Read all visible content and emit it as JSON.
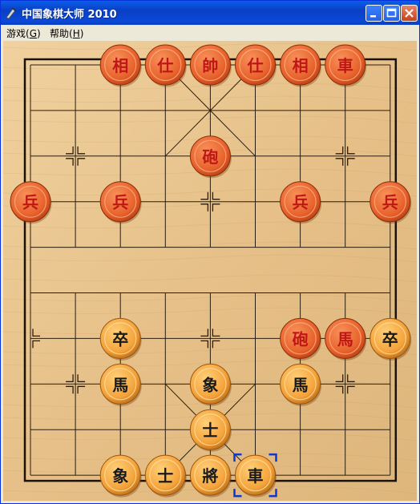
{
  "window": {
    "title": "中国象棋大师 2010",
    "minimize_label": "",
    "maximize_label": "",
    "close_label": ""
  },
  "menu": {
    "game": {
      "label": "游戏",
      "shortcut": "G"
    },
    "help": {
      "label": "帮助",
      "shortcut": "H"
    }
  },
  "colors": {
    "titlebar": "#0a4fd6",
    "board_wood": "#e9c58f",
    "red_piece_face": "#e9652f",
    "red_piece_text": "#c01616",
    "black_piece_face": "#f2a43a",
    "black_piece_text": "#1a1a1a",
    "selection": "#1038d0"
  },
  "board": {
    "files": 9,
    "ranks": 10,
    "red_pieces": [
      {
        "file": 2,
        "rank": 0,
        "label": "相"
      },
      {
        "file": 3,
        "rank": 0,
        "label": "仕"
      },
      {
        "file": 4,
        "rank": 0,
        "label": "帥"
      },
      {
        "file": 5,
        "rank": 0,
        "label": "仕"
      },
      {
        "file": 6,
        "rank": 0,
        "label": "相"
      },
      {
        "file": 7,
        "rank": 0,
        "label": "車"
      },
      {
        "file": 4,
        "rank": 2,
        "label": "砲"
      },
      {
        "file": 0,
        "rank": 3,
        "label": "兵"
      },
      {
        "file": 2,
        "rank": 3,
        "label": "兵"
      },
      {
        "file": 6,
        "rank": 3,
        "label": "兵"
      },
      {
        "file": 8,
        "rank": 3,
        "label": "兵"
      },
      {
        "file": 6,
        "rank": 6,
        "label": "砲"
      },
      {
        "file": 7,
        "rank": 6,
        "label": "馬"
      }
    ],
    "black_pieces": [
      {
        "file": 2,
        "rank": 6,
        "label": "卒"
      },
      {
        "file": 8,
        "rank": 6,
        "label": "卒"
      },
      {
        "file": 2,
        "rank": 7,
        "label": "馬"
      },
      {
        "file": 4,
        "rank": 7,
        "label": "象"
      },
      {
        "file": 6,
        "rank": 7,
        "label": "馬"
      },
      {
        "file": 4,
        "rank": 8,
        "label": "士"
      },
      {
        "file": 2,
        "rank": 9,
        "label": "象"
      },
      {
        "file": 3,
        "rank": 9,
        "label": "士"
      },
      {
        "file": 4,
        "rank": 9,
        "label": "將"
      },
      {
        "file": 5,
        "rank": 9,
        "label": "車"
      }
    ],
    "selected": {
      "file": 5,
      "rank": 9
    }
  }
}
